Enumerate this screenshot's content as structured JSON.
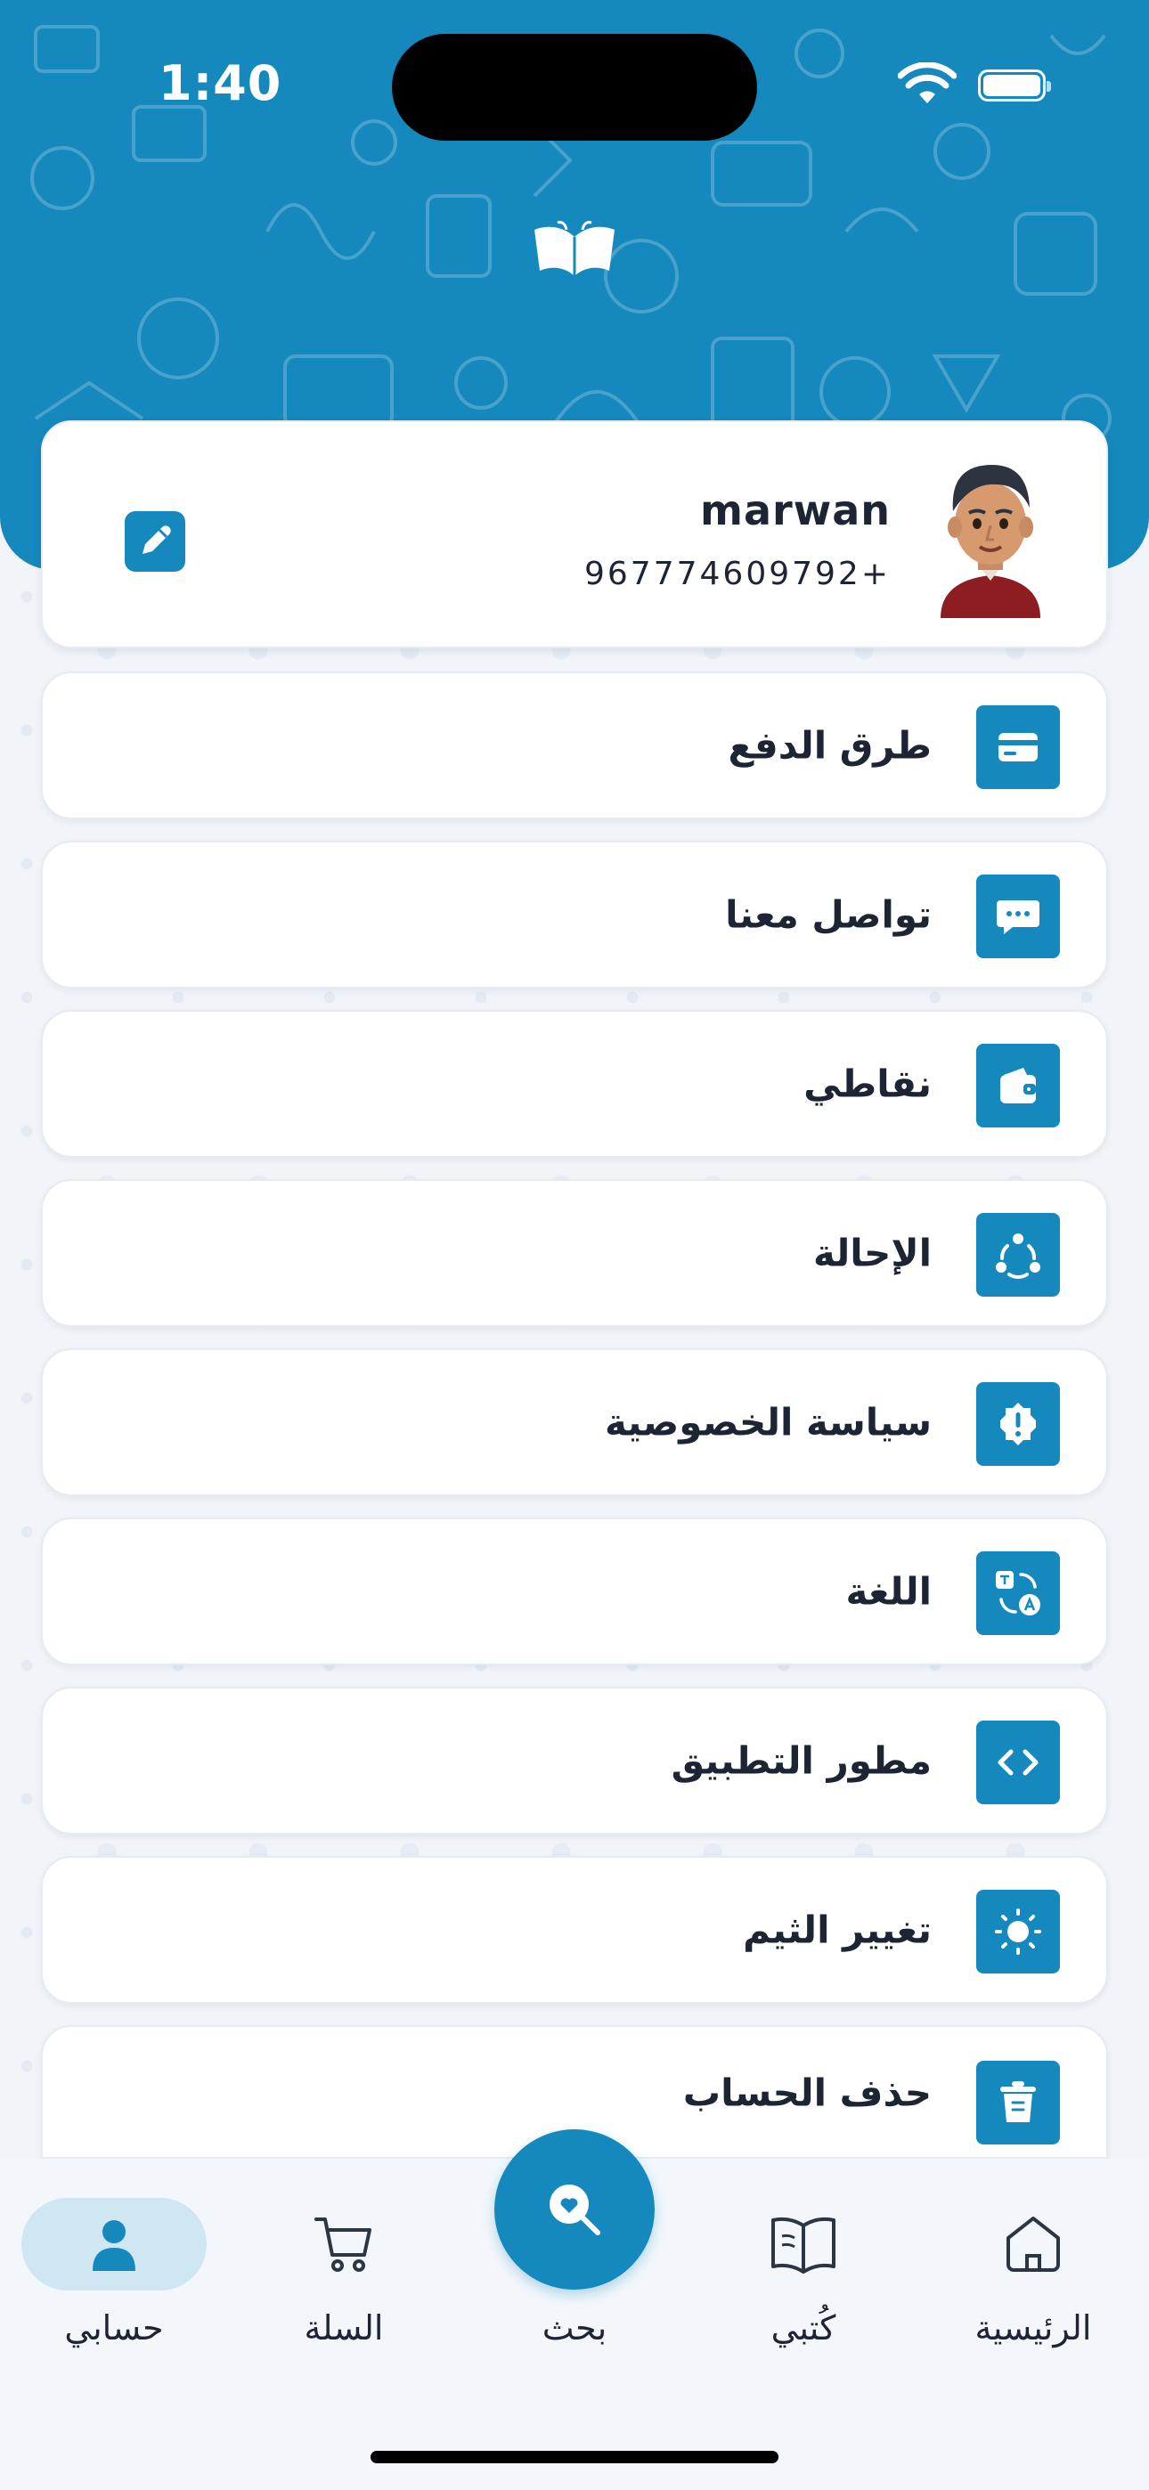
{
  "status_bar": {
    "time": "1:40"
  },
  "profile": {
    "name": "marwan",
    "phone": "967774609792+"
  },
  "menu": [
    {
      "label": "طرق الدفع",
      "icon": "credit-card-icon"
    },
    {
      "label": "تواصل معنا",
      "icon": "chat-bubble-icon"
    },
    {
      "label": "نقاطي",
      "icon": "wallet-icon"
    },
    {
      "label": "الإحالة",
      "icon": "share-icon"
    },
    {
      "label": "سياسة الخصوصية",
      "icon": "privacy-badge-icon"
    },
    {
      "label": "اللغة",
      "icon": "translate-icon"
    },
    {
      "label": "مطور التطبيق",
      "icon": "code-icon"
    },
    {
      "label": "تغيير الثيم",
      "icon": "sun-icon"
    },
    {
      "label": "حذف الحساب",
      "icon": "trash-icon"
    }
  ],
  "bottom_nav": {
    "account": "حسابي",
    "cart": "السلة",
    "search": "بحث",
    "my_books": "كُتبي",
    "home": "الرئيسية"
  },
  "colors": {
    "primary": "#1588bd",
    "active_pill": "#cfe6f3",
    "text": "#1d2433",
    "background": "#f1f5fa"
  }
}
